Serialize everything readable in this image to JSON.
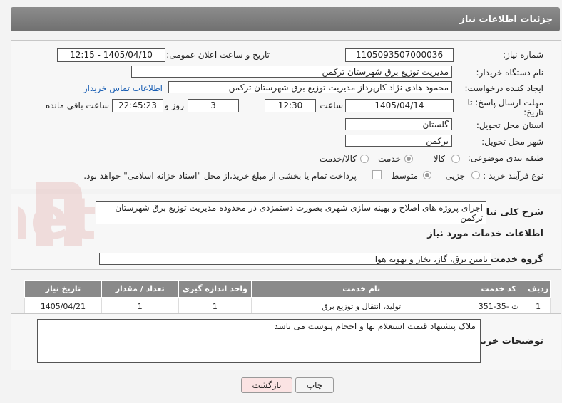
{
  "header": {
    "title": "جزئیات اطلاعات نیاز"
  },
  "fields": {
    "need_number_label": "شماره نیاز:",
    "need_number": "1105093507000036",
    "announce_label": "تاریخ و ساعت اعلان عمومی:",
    "announce_value": "1405/04/10 - 12:15",
    "buyer_org_label": "نام دستگاه خریدار:",
    "buyer_org": "مدیریت توزیع برق شهرستان ترکمن",
    "creator_label": "ایجاد کننده درخواست:",
    "creator": "محمود  هادی نژاد کارپرداز مدیریت توزیع برق شهرستان ترکمن",
    "contact_link": "اطلاعات تماس خریدار",
    "deadline_label_1": "مهلت ارسال پاسخ: تا",
    "deadline_label_2": "تاریخ:",
    "deadline_date": "1405/04/14",
    "time_word": "ساعت",
    "deadline_time": "12:30",
    "days_value": "3",
    "days_word": "روز و",
    "remaining_time": "22:45:23",
    "remaining_word": "ساعت باقی مانده",
    "province_label": "استان محل تحویل:",
    "province": "گلستان",
    "city_label": "شهر محل تحویل:",
    "city": "ترکمن",
    "category_label": "طبقه بندی موضوعی:",
    "category_options": [
      "کالا",
      "خدمت",
      "کالا/خدمت"
    ],
    "category_selected": "خدمت",
    "process_label": "نوع فرآیند خرید :",
    "process_options": [
      "جزیی",
      "متوسط"
    ],
    "process_selected": "متوسط",
    "payment_note": "پرداخت تمام یا بخشی از مبلغ خرید،از محل \"اسناد خزانه اسلامی\" خواهد بود."
  },
  "description": {
    "label": "شرح کلی نیاز:",
    "value": "اجرای پروژه های اصلاح و بهینه سازی شهری بصورت دستمزدی در محدوده مدیریت توزیع برق شهرستان ترکمن"
  },
  "services": {
    "section_title": "اطلاعات خدمات مورد نیاز",
    "group_label": "گروه خدمت:",
    "group_value": "تامین برق، گاز، بخار و تهویه هوا",
    "columns": [
      "ردیف",
      "کد خدمت",
      "نام خدمت",
      "واحد اندازه گیری",
      "تعداد / مقدار",
      "تاریخ نیاز"
    ],
    "rows": [
      [
        "1",
        "ت -35-351",
        "تولید، انتقال و توزیع برق",
        "1",
        "1",
        "1405/04/21"
      ]
    ]
  },
  "buyer_notes": {
    "label": "توضیحات خریدار:",
    "value": "ملاک پیشنهاد قیمت استعلام بها و احجام پیوست می باشد"
  },
  "buttons": {
    "print": "چاپ",
    "back": "بازگشت"
  },
  "watermark": "AriaTender.net"
}
